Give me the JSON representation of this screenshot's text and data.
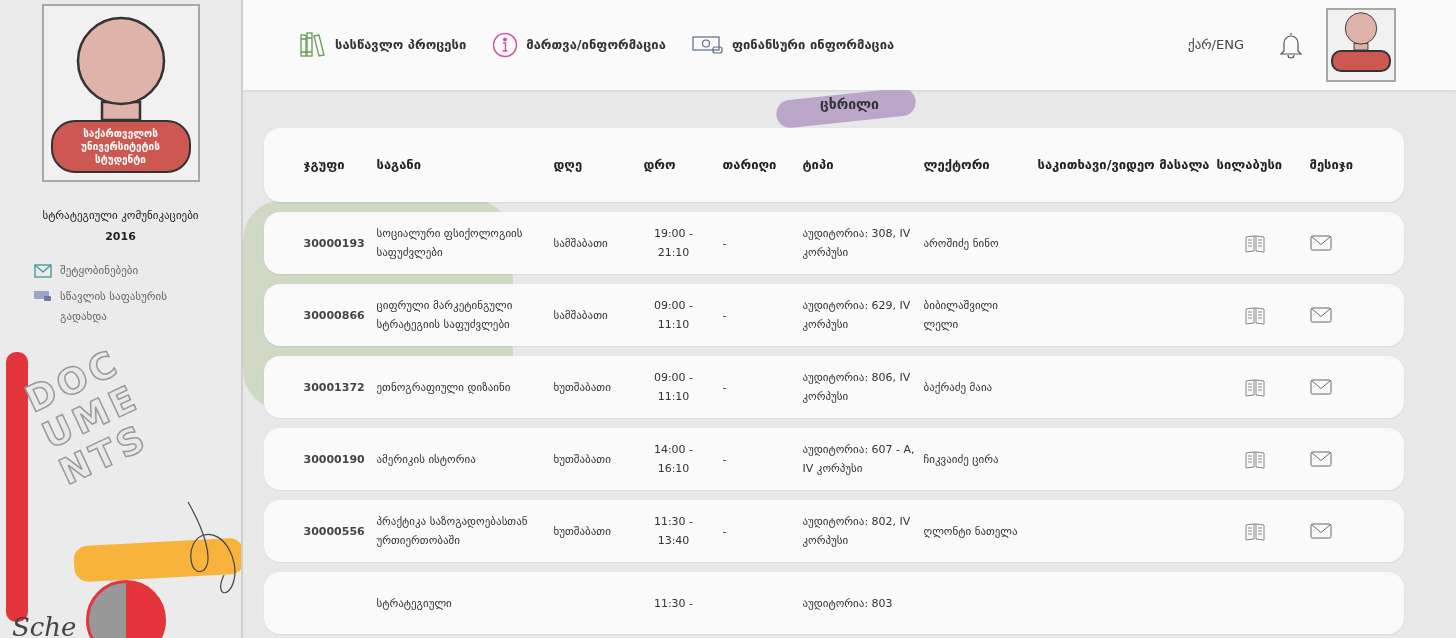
{
  "sidebar": {
    "avatar_caption": "საქართველოს უნივერსიტეტის სტუდენტი",
    "program": "სტრატეგიული კომუნიკაციები",
    "year": "2016",
    "links": [
      {
        "kind": "mail",
        "label": "შეტყობინებები"
      },
      {
        "kind": "payment",
        "label": "სწავლის საფასურის გადახდა"
      }
    ],
    "art_lettering": [
      "DOC",
      "UME",
      "NTS"
    ],
    "art_script": "Sche"
  },
  "nav": {
    "items": [
      {
        "kind": "books",
        "label": "სასწავლო პროცესი"
      },
      {
        "kind": "info",
        "label": "მართვა/ინფორმაცია"
      },
      {
        "kind": "money",
        "label": "ფინანსური ინფორმაცია"
      }
    ],
    "language": "ქარ/ENG"
  },
  "page_title": "ცხრილი",
  "table": {
    "columns": [
      "ჯგუფი",
      "საგანი",
      "დღე",
      "დრო",
      "თარიღი",
      "ტიპი",
      "ლექტორი",
      "საკითხავი/ვიდეო მასალა",
      "სილაბუსი",
      "მესიჯი"
    ],
    "rows": [
      {
        "group": "30000193",
        "subject": "სოციალური ფსიქოლოგიის საფუძვლები",
        "day": "სამშაბათი",
        "time": "19:00 - 21:10",
        "date": "-",
        "type": "აუდიტორია: 308, IV კორპუსი",
        "lecturer": "აროშიძე ნინო"
      },
      {
        "group": "30000866",
        "subject": "ციფრული მარკეტინგული სტრატეგიის საფუძვლები",
        "day": "სამშაბათი",
        "time": "09:00 - 11:10",
        "date": "-",
        "type": "აუდიტორია: 629, IV კორპუსი",
        "lecturer": "ბიბილაშვილი ლელი"
      },
      {
        "group": "30001372",
        "subject": "ეთნოგრაფიული დიზაინი",
        "day": "ხუთშაბათი",
        "time": "09:00 - 11:10",
        "date": "-",
        "type": "აუდიტორია: 806, IV კორპუსი",
        "lecturer": "ბაქრაძე მაია"
      },
      {
        "group": "30000190",
        "subject": "ამერიკის ისტორია",
        "day": "ხუთშაბათი",
        "time": "14:00 - 16:10",
        "date": "-",
        "type": "აუდიტორია: 607 - A, IV კორპუსი",
        "lecturer": "ჩიკვაიძე ცირა"
      },
      {
        "group": "30000556",
        "subject": "პრაქტიკა საზოგადოებასთან ურთიერთობაში",
        "day": "ხუთშაბათი",
        "time": "11:30 - 13:40",
        "date": "-",
        "type": "აუდიტორია: 802, IV კორპუსი",
        "lecturer": "ღლონტი ნათელა"
      },
      {
        "subject": "სტრატეგიული",
        "time": "11:30 -",
        "type": "აუდიტორია: 803"
      }
    ]
  }
}
